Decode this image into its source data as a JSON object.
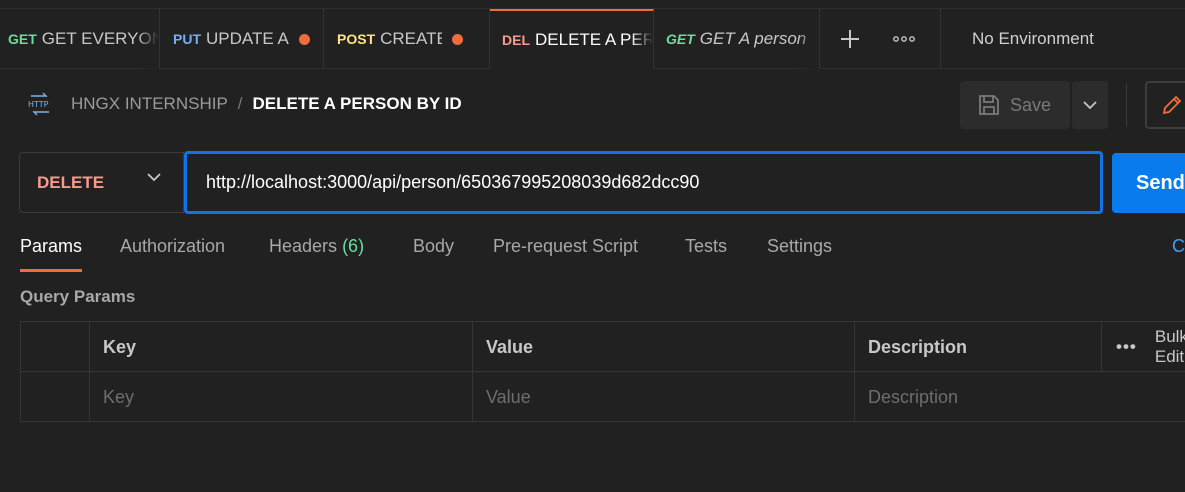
{
  "tabs": [
    {
      "method": "GET",
      "title": "GET EVERYONE",
      "dirty": false,
      "italic": false
    },
    {
      "method": "PUT",
      "title": "UPDATE A",
      "dirty": true,
      "italic": false
    },
    {
      "method": "POST",
      "title": "CREATE A",
      "dirty": true,
      "italic": false
    },
    {
      "method": "DEL",
      "title": "DELETE A PERSON BY ID",
      "dirty": false,
      "italic": false,
      "active": true
    },
    {
      "method": "GET",
      "title": "GET A person",
      "dirty": false,
      "italic": true
    }
  ],
  "tabbar": {
    "new_tab_icon": "plus-icon",
    "more_icon": "ellipsis-icon",
    "environment": "No Environment"
  },
  "breadcrumb": {
    "icon": "http-icon",
    "icon_text": "HTTP",
    "collection": "HNGX INTERNSHIP",
    "separator": "/",
    "request_name": "DELETE A PERSON BY ID"
  },
  "actions": {
    "save_label": "Save",
    "send_label": "Send"
  },
  "request": {
    "method": "DELETE",
    "url": "http://localhost:3000/api/person/650367995208039d682dcc90"
  },
  "request_tabs": {
    "params": "Params",
    "authorization": "Authorization",
    "headers": "Headers",
    "headers_count": "(6)",
    "body": "Body",
    "pre_request": "Pre-request Script",
    "tests": "Tests",
    "settings": "Settings",
    "cookies": "Cookies"
  },
  "query_params": {
    "title": "Query Params",
    "columns": {
      "key": "Key",
      "value": "Value",
      "description": "Description"
    },
    "bulk_edit": "Bulk Edit",
    "placeholders": {
      "key": "Key",
      "value": "Value",
      "description": "Description"
    }
  },
  "colors": {
    "accent": "#f26b3a",
    "send": "#097bed",
    "url_focus": "#1074e7",
    "get": "#6bdd9a",
    "put": "#74aef6",
    "post": "#ffe47e",
    "delete": "#f79a8e"
  }
}
